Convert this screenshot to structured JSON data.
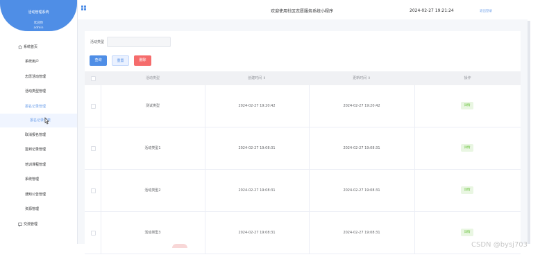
{
  "app": {
    "system_name": "活动管理系统",
    "user_line1": "欢迎你",
    "user_line2": "admin"
  },
  "header": {
    "title": "欢迎使用社区志愿服务系统小程序",
    "datetime": "2024-02-27 19:21:24",
    "logout": "退出登录"
  },
  "sidebar": {
    "items": [
      {
        "label": "系统首页",
        "icon": "home-icon",
        "top": true
      },
      {
        "label": "系统用户"
      },
      {
        "label": "志愿活动管理"
      },
      {
        "label": "活动类型管理"
      },
      {
        "label": "报名记录管理",
        "active": true
      },
      {
        "label": "报名记录列表",
        "sub": true
      },
      {
        "label": "取消报名管理"
      },
      {
        "label": "签到记录管理"
      },
      {
        "label": "培训课程管理"
      },
      {
        "label": "系统管理"
      },
      {
        "label": "通知公告管理"
      },
      {
        "label": "资源管理"
      },
      {
        "label": "交流管理",
        "icon": "chat-icon",
        "top": true
      }
    ]
  },
  "search": {
    "label": "活动类型",
    "placeholder": ""
  },
  "buttons": {
    "query": "查询",
    "add": "重置",
    "delete": "删除"
  },
  "table": {
    "headers": [
      "活动类型",
      "创建时间 ⇕",
      "更新时间 ⇕",
      "操作"
    ],
    "rows": [
      {
        "type": "测试类型",
        "created": "2024-02-27 19:20:42",
        "updated": "2024-02-27 19:20:42",
        "action": "详情"
      },
      {
        "type": "活动类型1",
        "created": "2024-02-27 19:08:31",
        "updated": "2024-02-27 19:08:31",
        "action": "详情"
      },
      {
        "type": "活动类型2",
        "created": "2024-02-27 19:08:31",
        "updated": "2024-02-27 19:08:31",
        "action": "详情"
      },
      {
        "type": "活动类型3",
        "created": "2024-02-27 19:08:31",
        "updated": "2024-02-27 19:08:31",
        "action": "详情"
      }
    ]
  },
  "watermark": "CSDN @bysj703",
  "colors": {
    "primary": "#4f8ee6",
    "danger": "#f56c6c",
    "success": "#67c23a"
  }
}
